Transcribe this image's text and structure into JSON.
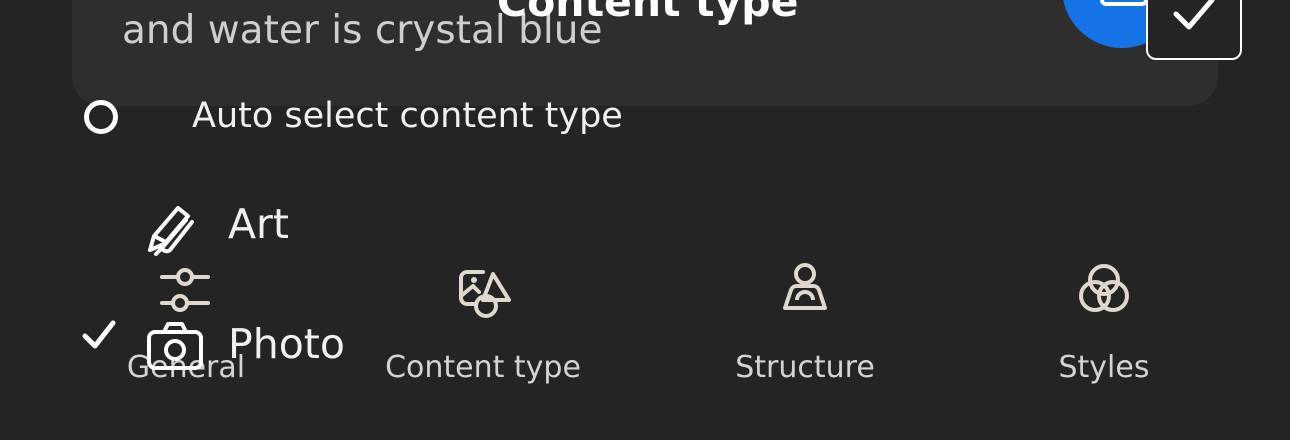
{
  "prompt": {
    "text": "and water is crystal blue"
  },
  "sheet": {
    "title": "Content type"
  },
  "auto_select": {
    "label": "Auto select content type",
    "selected": false
  },
  "content_types": [
    {
      "label": "Art",
      "icon": "pen-brush-icon",
      "checked": false
    },
    {
      "label": "Photo",
      "icon": "camera-icon",
      "checked": true
    }
  ],
  "tabs": [
    {
      "label": "General",
      "icon": "sliders-icon"
    },
    {
      "label": "Content type",
      "icon": "image-shapes-icon"
    },
    {
      "label": "Structure",
      "icon": "structure-person-icon"
    },
    {
      "label": "Styles",
      "icon": "overlapping-circles-icon"
    }
  ],
  "colors": {
    "background": "#242424",
    "accent": "#1473e6",
    "text": "#f0f0f0"
  }
}
